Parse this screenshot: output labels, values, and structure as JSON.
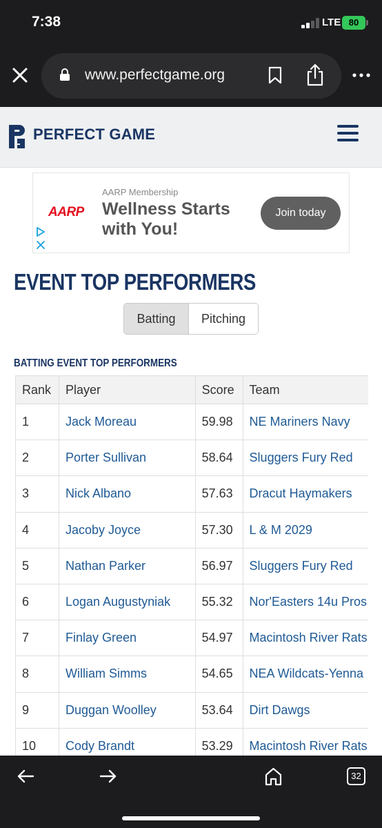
{
  "status_bar": {
    "time": "7:38",
    "network": "LTE",
    "battery": "80"
  },
  "browser": {
    "url": "www.perfectgame.org",
    "tab_count": "32"
  },
  "site": {
    "brand": "PERFECT GAME",
    "brand_color": "#1a3563"
  },
  "ad": {
    "logo": "AARP",
    "subtitle": "AARP Membership",
    "headline": "Wellness Starts with You!",
    "cta": "Join today"
  },
  "page": {
    "title": "EVENT TOP PERFORMERS",
    "tabs": [
      {
        "label": "Batting",
        "active": true
      },
      {
        "label": "Pitching",
        "active": false
      }
    ],
    "section_title": "BATTING EVENT TOP PERFORMERS"
  },
  "table": {
    "headers": [
      "Rank",
      "Player",
      "Score",
      "Team"
    ],
    "rows": [
      {
        "rank": "1",
        "player": "Jack Moreau",
        "score": "59.98",
        "team": "NE Mariners Navy"
      },
      {
        "rank": "2",
        "player": "Porter Sullivan",
        "score": "58.64",
        "team": "Sluggers Fury Red"
      },
      {
        "rank": "3",
        "player": "Nick Albano",
        "score": "57.63",
        "team": "Dracut Haymakers"
      },
      {
        "rank": "4",
        "player": "Jacoby Joyce",
        "score": "57.30",
        "team": "L & M 2029"
      },
      {
        "rank": "5",
        "player": "Nathan Parker",
        "score": "56.97",
        "team": "Sluggers Fury Red"
      },
      {
        "rank": "6",
        "player": "Logan Augustyniak",
        "score": "55.32",
        "team": "Nor'Easters 14u Pros"
      },
      {
        "rank": "7",
        "player": "Finlay Green",
        "score": "54.97",
        "team": "Macintosh River Rats"
      },
      {
        "rank": "8",
        "player": "William Simms",
        "score": "54.65",
        "team": "NEA Wildcats-Yenna"
      },
      {
        "rank": "9",
        "player": "Duggan Woolley",
        "score": "53.64",
        "team": "Dirt Dawgs"
      },
      {
        "rank": "10",
        "player": "Cody Brandt",
        "score": "53.29",
        "team": "Macintosh River Rats"
      }
    ]
  }
}
